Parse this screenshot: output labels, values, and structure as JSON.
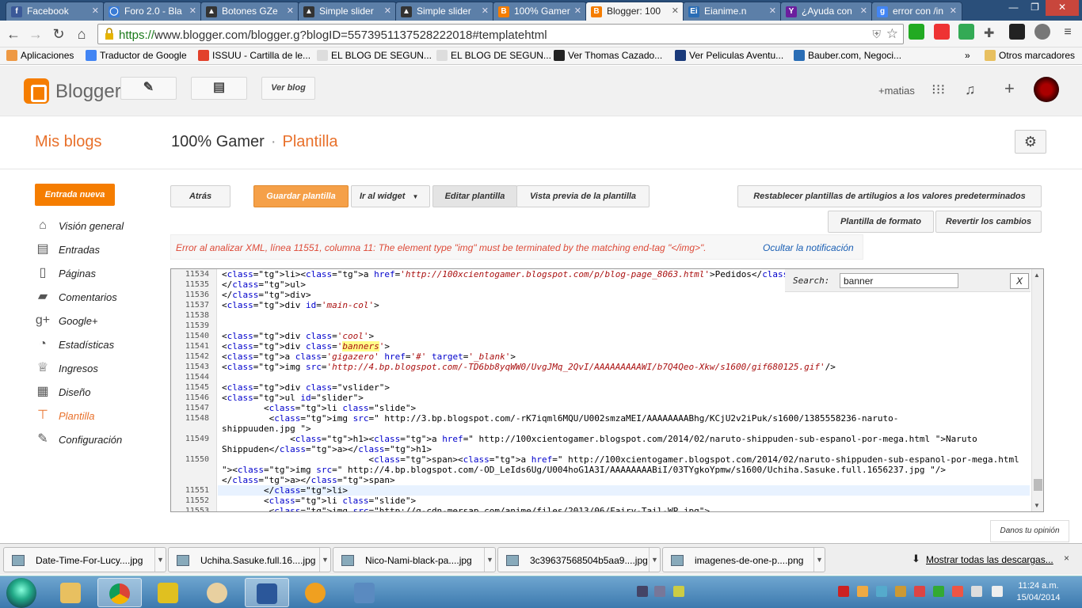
{
  "browser": {
    "tabs": [
      {
        "title": "Facebook",
        "color": "#3b5998",
        "glyph": "f"
      },
      {
        "title": "Foro 2.0 - Bla",
        "color": "#3a7bd5",
        "glyph": "◯"
      },
      {
        "title": "Botones GZe",
        "color": "#333333",
        "glyph": "▲"
      },
      {
        "title": "Simple slider",
        "color": "#333333",
        "glyph": "▲"
      },
      {
        "title": "Simple slider",
        "color": "#333333",
        "glyph": "▲"
      },
      {
        "title": "100% Gamer",
        "color": "#f57d00",
        "glyph": "B"
      },
      {
        "title": "Blogger: 100",
        "color": "#f57d00",
        "glyph": "B"
      },
      {
        "title": "Eianime.n",
        "color": "#2a6db5",
        "glyph": "Ei"
      },
      {
        "title": "¿Ayuda con",
        "color": "#6b1e9e",
        "glyph": "Y"
      },
      {
        "title": "error con /in",
        "color": "#4285f4",
        "glyph": "g"
      }
    ],
    "url": "https://www.blogger.com/blogger.g?blogID=5573951137528222018#templatehtml",
    "url_prefix": "https://",
    "url_rest": "www.blogger.com/blogger.g?blogID=5573951137528222018#templatehtml",
    "bookmarks": [
      {
        "label": "Aplicaciones",
        "color": "#e94"
      },
      {
        "label": "Traductor de Google",
        "color": "#4285f4"
      },
      {
        "label": "ISSUU - Cartilla de le...",
        "color": "#e2412b"
      },
      {
        "label": "EL BLOG DE SEGUN...",
        "color": "#dddddd"
      },
      {
        "label": "EL BLOG DE SEGUN...",
        "color": "#dddddd"
      },
      {
        "label": "Ver Thomas Cazado...",
        "color": "#222222"
      },
      {
        "label": "Ver Peliculas Aventu...",
        "color": "#1a3a7a"
      },
      {
        "label": "Bauber.com, Negoci...",
        "color": "#2a6db5"
      }
    ],
    "bookmarks_more": "»",
    "other_bookmarks": "Otros marcadores"
  },
  "blogger": {
    "brand": "Blogger",
    "view_blog": "Ver blog",
    "user": "+matias",
    "my_blogs": "Mis blogs",
    "blog_name": "100% Gamer",
    "separator": "·",
    "page": "Plantilla",
    "new_post": "Entrada nueva",
    "nav": [
      {
        "label": "Visión general",
        "icon": "home-icon",
        "glyph": "⌂"
      },
      {
        "label": "Entradas",
        "icon": "posts-icon",
        "glyph": "▤"
      },
      {
        "label": "Páginas",
        "icon": "pages-icon",
        "glyph": "▯"
      },
      {
        "label": "Comentarios",
        "icon": "comments-icon",
        "glyph": "▰"
      },
      {
        "label": "Google+",
        "icon": "google-plus-icon",
        "glyph": "g+"
      },
      {
        "label": "Estadísticas",
        "icon": "stats-icon",
        "glyph": "◔"
      },
      {
        "label": "Ingresos",
        "icon": "trophy-icon",
        "glyph": "♕"
      },
      {
        "label": "Diseño",
        "icon": "layout-icon",
        "glyph": "▦"
      },
      {
        "label": "Plantilla",
        "icon": "template-icon",
        "glyph": "⊤"
      },
      {
        "label": "Configuración",
        "icon": "wrench-icon",
        "glyph": "✎"
      }
    ],
    "buttons": {
      "back": "Atrás",
      "save": "Guardar plantilla",
      "goto_widget": "Ir al widget",
      "edit": "Editar plantilla",
      "preview": "Vista previa de la plantilla",
      "reset_widgets": "Restablecer plantillas de artilugios a los valores predeterminados",
      "format": "Plantilla de formato",
      "revert": "Revertir los cambios"
    },
    "error": "Error al analizar XML, línea 11551, columna 11: The element type \"img\" must be terminated by the matching end-tag \"</img>\".",
    "hide_notification": "Ocultar la notificación",
    "search_label": "Search:",
    "search_value": "banner",
    "search_close": "X",
    "feedback": "Danos tu opinión"
  },
  "code": {
    "line_numbers": [
      "11534",
      "11535",
      "11536",
      "11537",
      "11538",
      "11539",
      "11540",
      "11541",
      "11542",
      "11543",
      "11544",
      "11545",
      "11546",
      "11547",
      "11548",
      "",
      "11549",
      "",
      "11550",
      "",
      "",
      "11551",
      "11552",
      "11553"
    ],
    "lines": [
      "<li><a href='http://100xcientogamer.blogspot.com/p/blog-page_8063.html'>Pedidos</a></li>",
      "</ul>",
      "</div>",
      "<div id='main-col'>",
      "",
      "",
      "<div class='cool'>",
      "<div class='banners'>",
      "<a class='gigazero' href='#' target='_blank'>",
      "<img src='http://4.bp.blogspot.com/-TD6bb8yqWW0/UvgJMq_2QvI/AAAAAAAAAWI/b7Q4Qeo-Xkw/s1600/gif680125.gif'/>",
      "",
      "<div class=\"vslider\">",
      "<ul id=\"slider\">",
      "        <li class=\"slide\">",
      "         <img src=\" http://3.bp.blogspot.com/-rK7iqml6MQU/U002smzaMEI/AAAAAAAABhg/KCjU2v2iPuk/s1600/1385558236-naruto-",
      "shippuuden.jpg \">",
      "             <h1><a href=\" http://100xcientogamer.blogspot.com/2014/02/naruto-shippuden-sub-espanol-por-mega.html \">Naruto",
      "Shippuden</a></h1>",
      "                            <span><a href=\" http://100xcientogamer.blogspot.com/2014/02/naruto-shippuden-sub-espanol-por-mega.html",
      "\"><img src=\" http://4.bp.blogspot.com/-OD_LeIds6Ug/U004hoG1A3I/AAAAAAAABiI/03TYgkoYpmw/s1600/Uchiha.Sasuke.full.1656237.jpg \"/>",
      "</a></span>",
      "        </li>",
      "        <li class=\"slide\">",
      "         <img src=\"http://g-cdn-mersap.com/anime/files/2013/06/Fairy-Tail-WP.jpg\">"
    ]
  },
  "downloads": {
    "items": [
      "Date-Time-For-Lucy....jpg",
      "Uchiha.Sasuke.full.16....jpg",
      "Nico-Nami-black-pa....jpg",
      "3c39637568504b5aa9....jpg",
      "imagenes-de-one-p....png"
    ],
    "show_all": "Mostrar todas las descargas...",
    "close": "×"
  },
  "taskbar": {
    "time": "11:24 a.m.",
    "date": "15/04/2014"
  }
}
